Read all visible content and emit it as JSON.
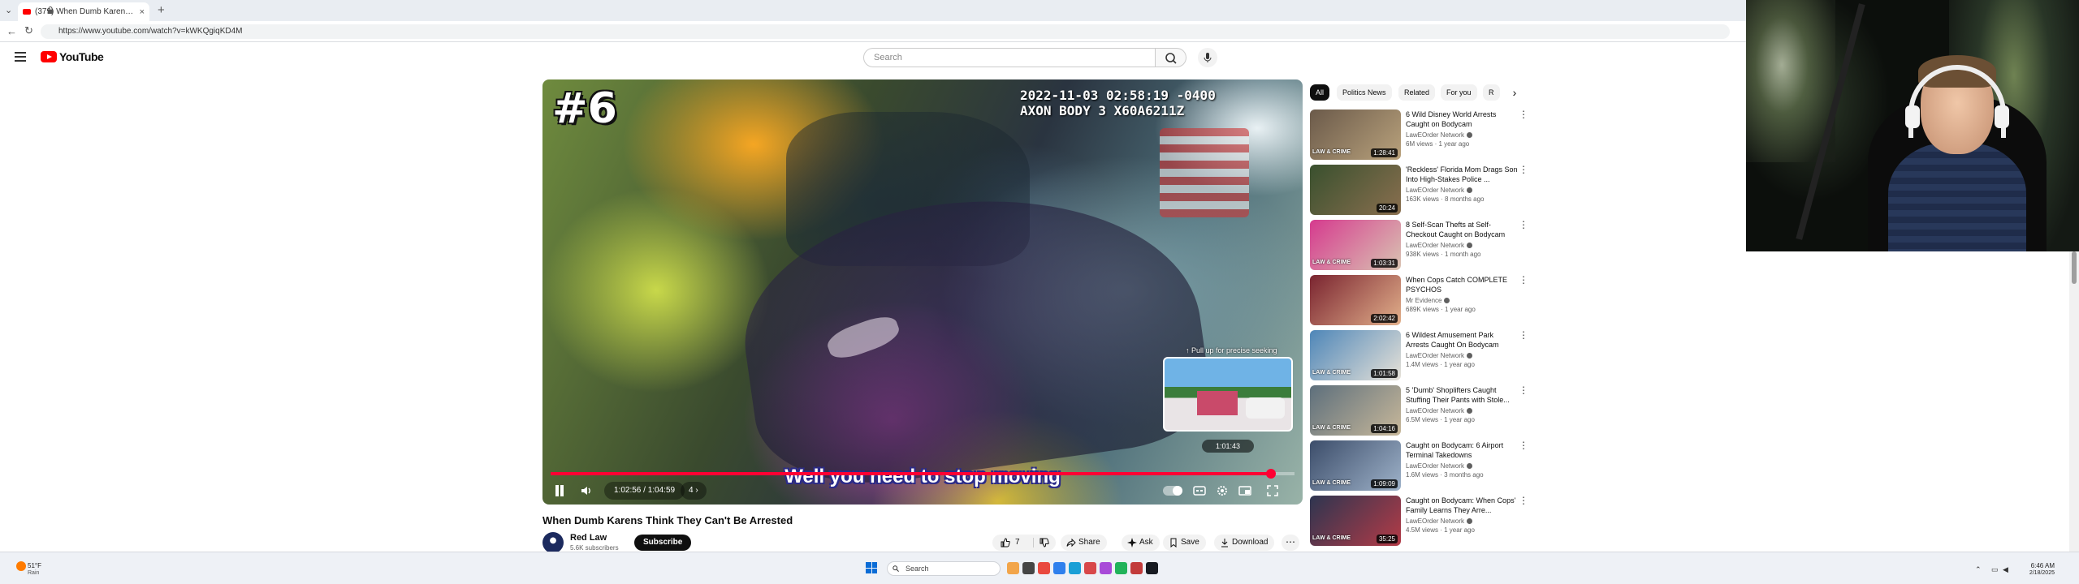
{
  "browser": {
    "tab_title": "(379) When Dumb Karens Thi",
    "url": "https://www.youtube.com/watch?v=kWKQgiqKD4M"
  },
  "youtube": {
    "wordmark": "YouTube",
    "search_placeholder": "Search"
  },
  "player": {
    "episode_number": "#6",
    "cam_timestamp": "2022-11-03 02:58:19 -0400",
    "cam_device": "AXON BODY 3 X60A6211Z",
    "subtitle": "Well you need to stop moving",
    "seek_hint": "↑ Pull up for precise seeking",
    "seek_time": "1:01:43",
    "time_display": "1:02:56 / 1:04:59",
    "chapter": "4",
    "progress": 0.968,
    "progress_color": "#ff0033"
  },
  "video": {
    "title": "When Dumb Karens Think They Can't Be Arrested",
    "channel_name": "Red Law",
    "channel_subs": "5.6K subscribers",
    "subscribe_label": "Subscribe",
    "like_count": "7",
    "share_label": "Share",
    "ask_label": "Ask",
    "save_label": "Save",
    "download_label": "Download"
  },
  "chips": [
    {
      "label": "All",
      "active": true
    },
    {
      "label": "Politics News",
      "active": false
    },
    {
      "label": "Related",
      "active": false
    },
    {
      "label": "For you",
      "active": false
    },
    {
      "label": "R",
      "active": false
    }
  ],
  "recommendations": [
    {
      "title": "6 Wild Disney World Arrests Caught on Bodycam",
      "channel": "LawEOrder Network",
      "meta": "6M views · 1 year ago",
      "duration": "1:28:41",
      "thumb_colors": [
        "#6b5a4a",
        "#b9a27c"
      ]
    },
    {
      "title": "'Reckless' Florida Mom Drags Son Into High-Stakes Police ...",
      "channel": "LawEOrder Network",
      "meta": "163K views · 8 months ago",
      "duration": "20:24",
      "thumb_colors": [
        "#39502e",
        "#8a6f4f"
      ]
    },
    {
      "title": "8 Self-Scan Thefts at Self-Checkout Caught on Bodycam",
      "channel": "LawEOrder Network",
      "meta": "938K views · 1 month ago",
      "duration": "1:03:31",
      "thumb_colors": [
        "#d63a8e",
        "#d9c4b2"
      ]
    },
    {
      "title": "When Cops Catch COMPLETE PSYCHOS",
      "channel": "Mr Evidence",
      "meta": "689K views · 1 year ago",
      "duration": "2:02:42",
      "thumb_colors": [
        "#7a2430",
        "#e2b08b"
      ]
    },
    {
      "title": "6 Wildest Amusement Park Arrests Caught On Bodycam",
      "channel": "LawEOrder Network",
      "meta": "1.4M views · 1 year ago",
      "duration": "1:01:58",
      "thumb_colors": [
        "#4e86b8",
        "#e7e2d8"
      ]
    },
    {
      "title": "5 'Dumb' Shoplifters Caught Stuffing Their Pants with Stole...",
      "channel": "LawEOrder Network",
      "meta": "6.5M views · 1 year ago",
      "duration": "1:04:16",
      "thumb_colors": [
        "#5d6f7c",
        "#c8b89a"
      ]
    },
    {
      "title": "Caught on Bodycam: 6 Airport Terminal Takedowns",
      "channel": "LawEOrder Network",
      "meta": "1.6M views · 3 months ago",
      "duration": "1:09:09",
      "thumb_colors": [
        "#3c4d6a",
        "#9eb2c9"
      ]
    },
    {
      "title": "Caught on Bodycam: When Cops' Family Learns They Arre...",
      "channel": "LawEOrder Network",
      "meta": "4.5M views · 1 year ago",
      "duration": "35:25",
      "thumb_colors": [
        "#2d3550",
        "#b43b47"
      ]
    }
  ],
  "rec_badge": "LAW & CRIME",
  "taskbar": {
    "weather_temp": "51°F",
    "weather_desc": "Rain",
    "search_label": "Search",
    "time": "6:46 AM",
    "date": "2/18/2025",
    "apps": [
      "#f2a54a",
      "#454545",
      "#e9493f",
      "#2f80ed",
      "#1a9fd6",
      "#d8484a",
      "#a84ad8",
      "#21b35a",
      "#c23b3b",
      "#171a21"
    ]
  }
}
